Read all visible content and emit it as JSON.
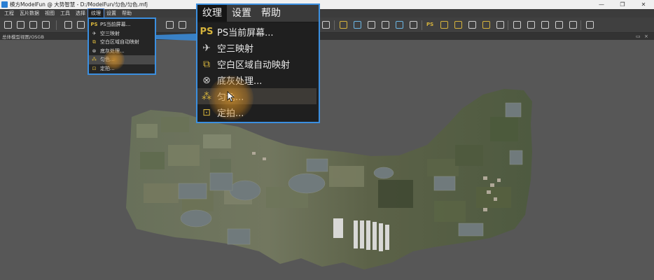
{
  "window": {
    "title": "模方ModelFun @ 大势智慧 - D:/ModelFun/匀色/匀色.mfj",
    "minimize": "—",
    "restore": "❐",
    "close": "✕"
  },
  "menubar": {
    "items": [
      "工程",
      "瓦片数据",
      "视图",
      "工具",
      "选择",
      "纹理",
      "设置",
      "帮助"
    ],
    "active_index": 5
  },
  "viewport_header": {
    "label": "总体模型视图/OSGB",
    "undock": "▭",
    "close": "×"
  },
  "texture_menu": {
    "items": [
      {
        "label": "PS当前屏幕...",
        "icon": "ps-icon"
      },
      {
        "label": "空三映射",
        "icon": "aerial-mapping-icon"
      },
      {
        "label": "空白区域自动映射",
        "icon": "auto-map-icon"
      },
      {
        "label": "底灰处理...",
        "icon": "gray-process-icon"
      },
      {
        "label": "匀色...",
        "icon": "color-balance-icon"
      },
      {
        "label": "定拍...",
        "icon": "fixed-shot-icon"
      }
    ],
    "highlighted_index": 4
  },
  "zoom_menubar": {
    "items": [
      "纹理",
      "设置",
      "帮助"
    ],
    "active_index": 0
  },
  "colors": {
    "accent_blue": "#3b8fe0",
    "icon_yellow": "#d6b43c",
    "highlight_glow": "#dc9628"
  }
}
